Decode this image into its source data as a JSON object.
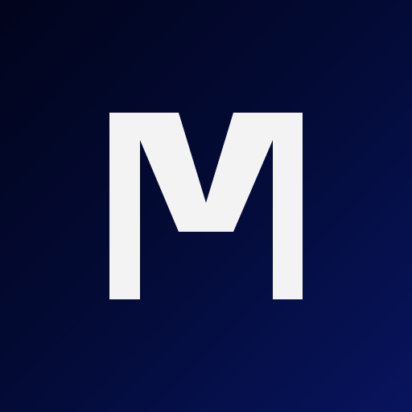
{
  "logo": {
    "letter": "M",
    "glyph_color": "#f3f3f4"
  },
  "background": {
    "gradient_start": "#02041c",
    "gradient_mid": "#030b36",
    "gradient_end": "#08145e"
  }
}
